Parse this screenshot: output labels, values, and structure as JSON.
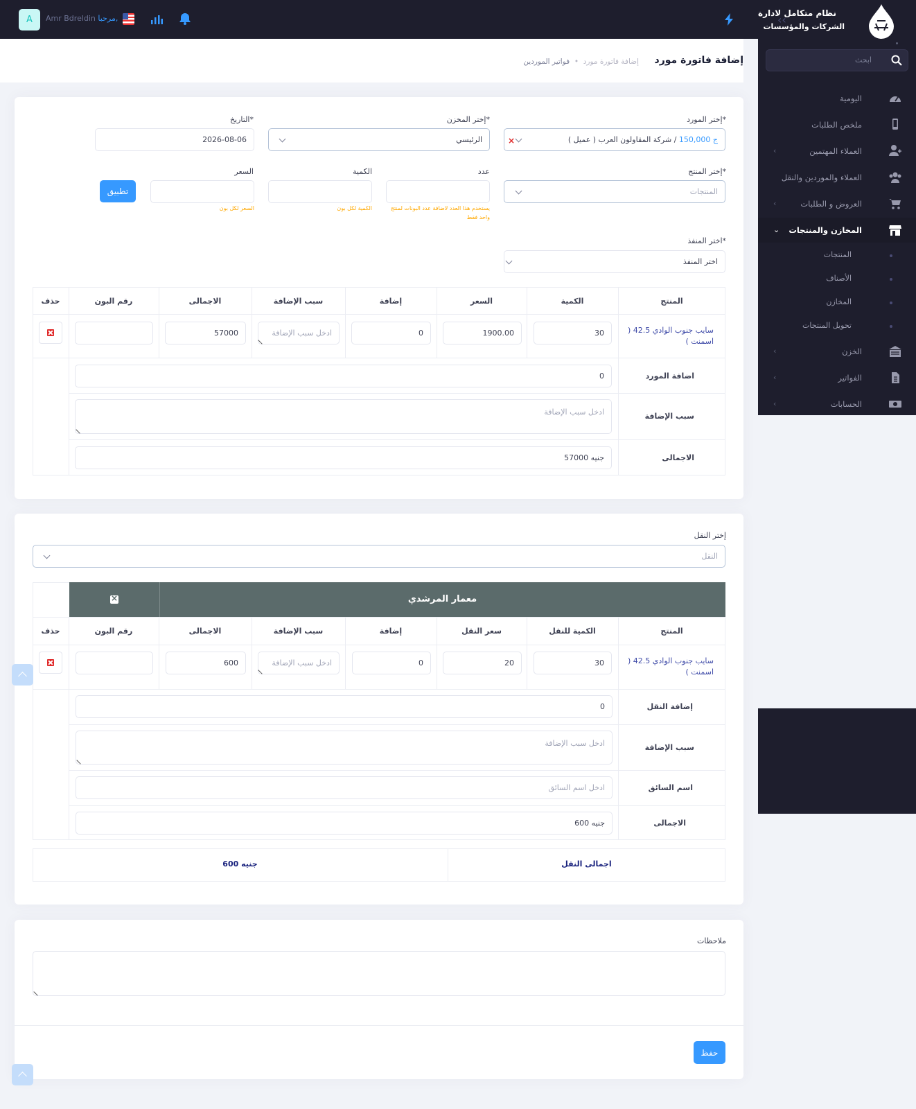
{
  "topbar": {
    "avatar_letter": "A",
    "greeting": "مرحبا,",
    "user_name": "Amr Bdreldin",
    "icons": [
      "us-flag-icon",
      "chart-bars-icon",
      "notification-bell-icon",
      "lightning-icon"
    ]
  },
  "sidebar": {
    "brand_line1": "نظام متكامل لادارة",
    "brand_line2": "الشركات والمؤسسات",
    "search_placeholder": "ابحث",
    "items": [
      {
        "label": "اليومية",
        "icon": "dashboard-icon"
      },
      {
        "label": "ملخص الطلبات",
        "icon": "phone-icon"
      },
      {
        "label": "العملاء المهتمين",
        "icon": "user-icon"
      },
      {
        "label": "العملاء والموردين والنقل",
        "icon": "users-icon"
      },
      {
        "label": "العروض و الطلبات",
        "icon": "cart-icon"
      },
      {
        "label": "المخازن والمنتجات",
        "icon": "store-icon"
      },
      {
        "label": "الخزن",
        "icon": "safe-icon"
      },
      {
        "label": "الفواتير",
        "icon": "invoice-icon"
      },
      {
        "label": "الحسابات",
        "icon": "money-icon"
      }
    ],
    "sub_items": [
      "المنتجات",
      "الأصناف",
      "المخازن",
      "تحويل المنتجات"
    ]
  },
  "header": {
    "page_title": "إضافة فاتورة مورد",
    "breadcrumb_parent": "فواتير الموردين",
    "breadcrumb_current": "إضافة فاتورة مورد"
  },
  "invoice": {
    "supplier_label": "إختر المورد*",
    "supplier_value": "شركة المقاولون العرب ( عميل ) /",
    "supplier_balance": "150,000 ج",
    "warehouse_label": "إختر المخزن*",
    "warehouse_value": "الرئيسي",
    "date_label": "التاريخ*",
    "date_value": "2026-08-06",
    "product_label": "إختر المنتج*",
    "product_placeholder": "المنتجات",
    "count_label": "عدد",
    "count_hint": "يستخدم هذا العدد لاضافة عدد البونات لمنتج واحد فقط",
    "qty_label": "الكمية",
    "qty_hint": "الكمية لكل بون",
    "price_label": "السعر",
    "price_hint": "السعر لكل بون",
    "apply_button": "تطبيق",
    "outlet_label": "اختر المنفذ*",
    "outlet_placeholder": "اختر المنفذ",
    "table_headers": [
      "المنتج",
      "الكمية",
      "السعر",
      "إضافة",
      "سبب الإضافة",
      "الاجمالى",
      "رقم البون",
      "حذف"
    ],
    "row": {
      "product": "سايب جنوب الوادي 42.5 ( اسمنت )",
      "qty": "30",
      "price": "1900.00",
      "addition": "0",
      "reason_placeholder": "ادخل سبب الإضافة",
      "total": "57000",
      "voucher": ""
    },
    "supplier_addition_label": "اضافة المورد",
    "supplier_addition_value": "0",
    "reason_label": "سبب الإضافة",
    "reason_placeholder": "ادخل سبب الإضافة",
    "total_label": "الاجمالى",
    "total_value": "57000 جنيه"
  },
  "transport": {
    "select_label": "إختر النقل",
    "select_placeholder": "النقل",
    "carrier_name": "معمار المرشدي",
    "table_headers": [
      "المنتج",
      "الكمية للنقل",
      "سعر النقل",
      "إضافة",
      "سبب الإضافة",
      "الاجمالى",
      "رقم البون",
      "حذف"
    ],
    "row": {
      "product": "سايب جنوب الوادي 42.5 ( اسمنت )",
      "qty": "30",
      "price": "20",
      "addition": "0",
      "reason_placeholder": "ادخل سبب الإضافة",
      "total": "600",
      "voucher": ""
    },
    "addition_label": "إضافة النقل",
    "addition_value": "0",
    "reason_label": "سبب الإضافة",
    "reason_placeholder": "ادخل سبب الإضافة",
    "driver_label": "اسم السائق",
    "driver_placeholder": "ادخل اسم السائق",
    "total_label": "الاجمالى",
    "total_value": "600 جنيه",
    "grand_label": "اجمالى النقل",
    "grand_value": "600 جنيه"
  },
  "notes": {
    "label": "ملاحظات",
    "save_button": "حفظ"
  },
  "colors": {
    "dark": "#1e1e2d",
    "primary": "#3699ff",
    "carrier_header": "#5b6b6b",
    "danger": "#e02a2a",
    "warning_text": "#ffa800"
  }
}
